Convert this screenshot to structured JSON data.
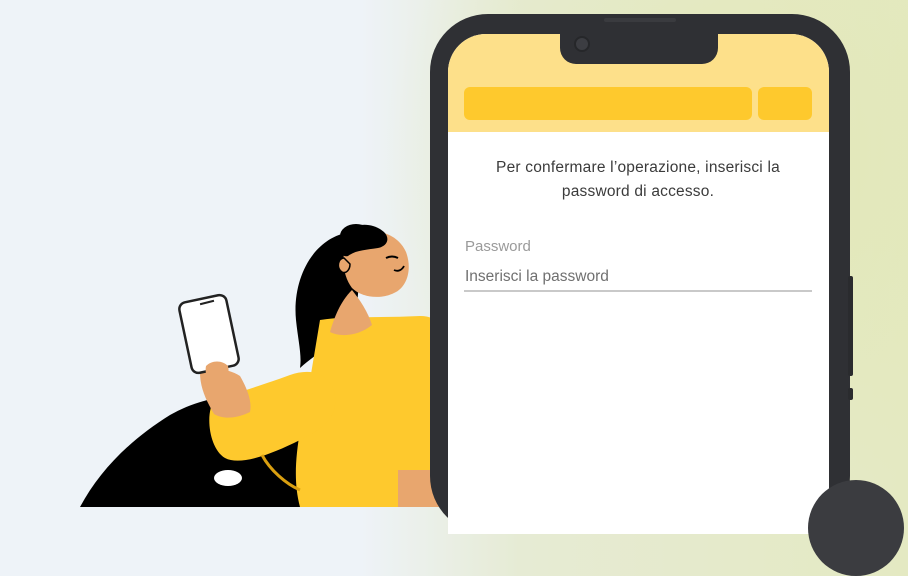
{
  "screen": {
    "message": "Per confermare l’operazione, inserisci la password di accesso.",
    "password_label": "Password",
    "password_placeholder": "Inserisci la password",
    "password_value": ""
  },
  "colors": {
    "header": "#fde08a",
    "header_bar": "#fec92d",
    "phone_frame": "#2f3034",
    "shirt": "#fec92d",
    "skin": "#e8a66e",
    "hair": "#000000"
  },
  "icons": {
    "floating_button": "round-action-icon"
  }
}
